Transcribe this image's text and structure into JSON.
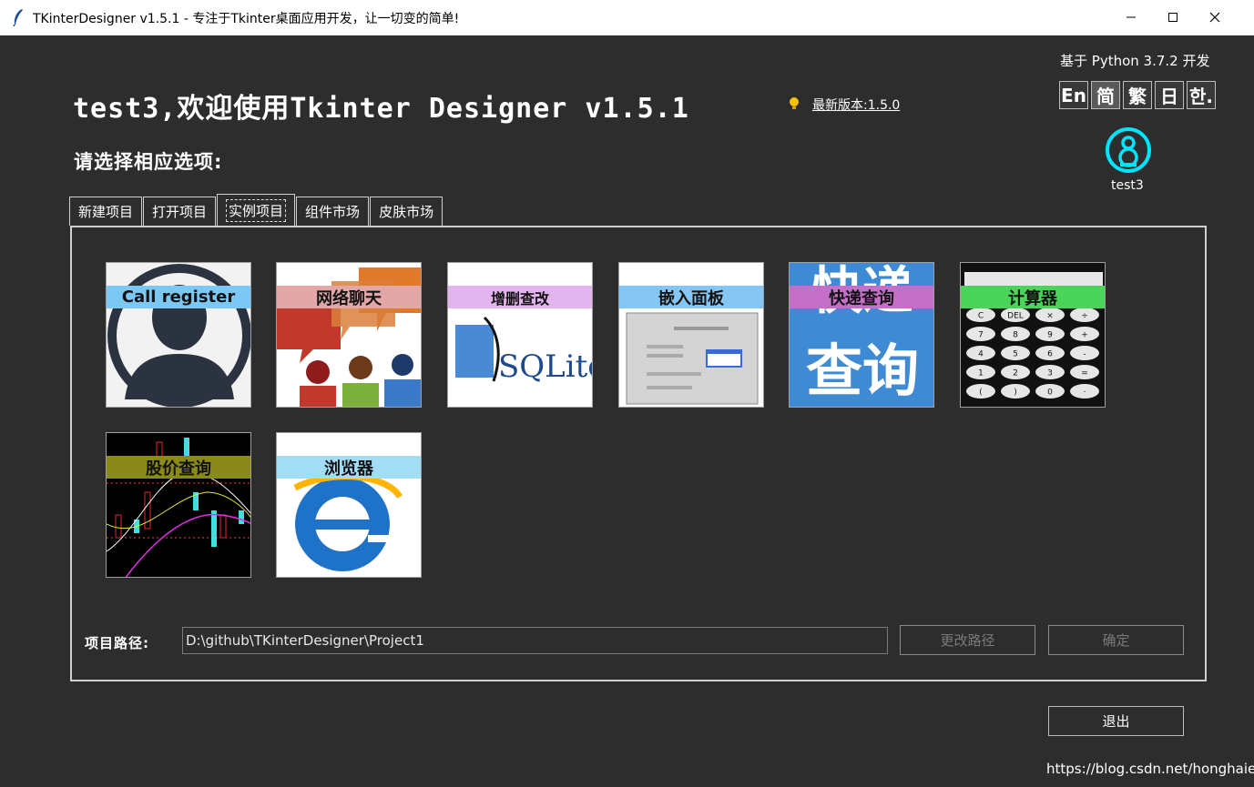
{
  "window": {
    "title": "TKinterDesigner v1.5.1 - 专注于Tkinter桌面应用开发，让一切变的简单!"
  },
  "header": {
    "welcome": "test3,欢迎使用Tkinter Designer v1.5.1",
    "latest_version": "最新版本:1.5.0",
    "python_base": "基于 Python 3.7.2 开发",
    "subtitle": "请选择相应选项:"
  },
  "languages": [
    {
      "label": "En",
      "active": false
    },
    {
      "label": "简",
      "active": true
    },
    {
      "label": "繁",
      "active": false
    },
    {
      "label": "日",
      "active": false
    },
    {
      "label": "한.",
      "active": false
    }
  ],
  "user": {
    "name": "test3"
  },
  "tabs": [
    {
      "label": "新建项目"
    },
    {
      "label": "打开项目"
    },
    {
      "label": "实例项目",
      "active": true
    },
    {
      "label": "组件市场"
    },
    {
      "label": "皮肤市场"
    }
  ],
  "examples": [
    {
      "label": "Call register"
    },
    {
      "label": "网络聊天"
    },
    {
      "label": "增删查改"
    },
    {
      "label": "嵌入面板"
    },
    {
      "label": "快递查询"
    },
    {
      "label": "计算器"
    },
    {
      "label": "股价查询"
    },
    {
      "label": "浏览器"
    }
  ],
  "thumb_text": {
    "sqlite": "SQLite",
    "kuaidi_top": "快递",
    "kuaidi_bottom": "查询",
    "calc_keys": [
      "C",
      "DEL",
      "×",
      "÷",
      "7",
      "8",
      "9",
      "+",
      "4",
      "5",
      "6",
      "-",
      "1",
      "2",
      "3",
      "=",
      "(",
      ")",
      "0",
      "·"
    ]
  },
  "project": {
    "path_label": "项目路径:",
    "path_value": "D:\\github\\TKinterDesigner\\Project1",
    "change_path": "更改路径",
    "confirm": "确定",
    "exit": "退出"
  },
  "watermark": "https://blog.csdn.net/honghaier",
  "colors": {
    "background": "#2d2d2d",
    "avatar": "#00e5ff"
  }
}
